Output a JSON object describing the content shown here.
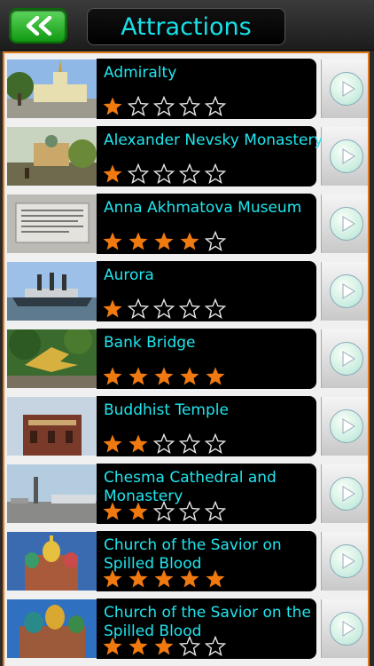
{
  "header": {
    "title": "Attractions",
    "back_icon": "double-chevron-left-icon"
  },
  "items": [
    {
      "name": "Admiralty",
      "rating": 1
    },
    {
      "name": "Alexander Nevsky Monastery",
      "rating": 1
    },
    {
      "name": "Anna Akhmatova Museum",
      "rating": 4
    },
    {
      "name": "Aurora",
      "rating": 1
    },
    {
      "name": "Bank Bridge",
      "rating": 5
    },
    {
      "name": "Buddhist Temple",
      "rating": 2
    },
    {
      "name": "Chesma Cathedral and Monastery",
      "rating": 2
    },
    {
      "name": "Church of the Savior on Spilled Blood",
      "rating": 5
    },
    {
      "name": "Church of the Savior on the Spilled Blood",
      "rating": 3
    }
  ],
  "max_rating": 5,
  "colors": {
    "accent": "#20e6ee",
    "star_filled": "#f07a10",
    "frame": "#e07a1a",
    "back_button": "#1aa81a"
  }
}
